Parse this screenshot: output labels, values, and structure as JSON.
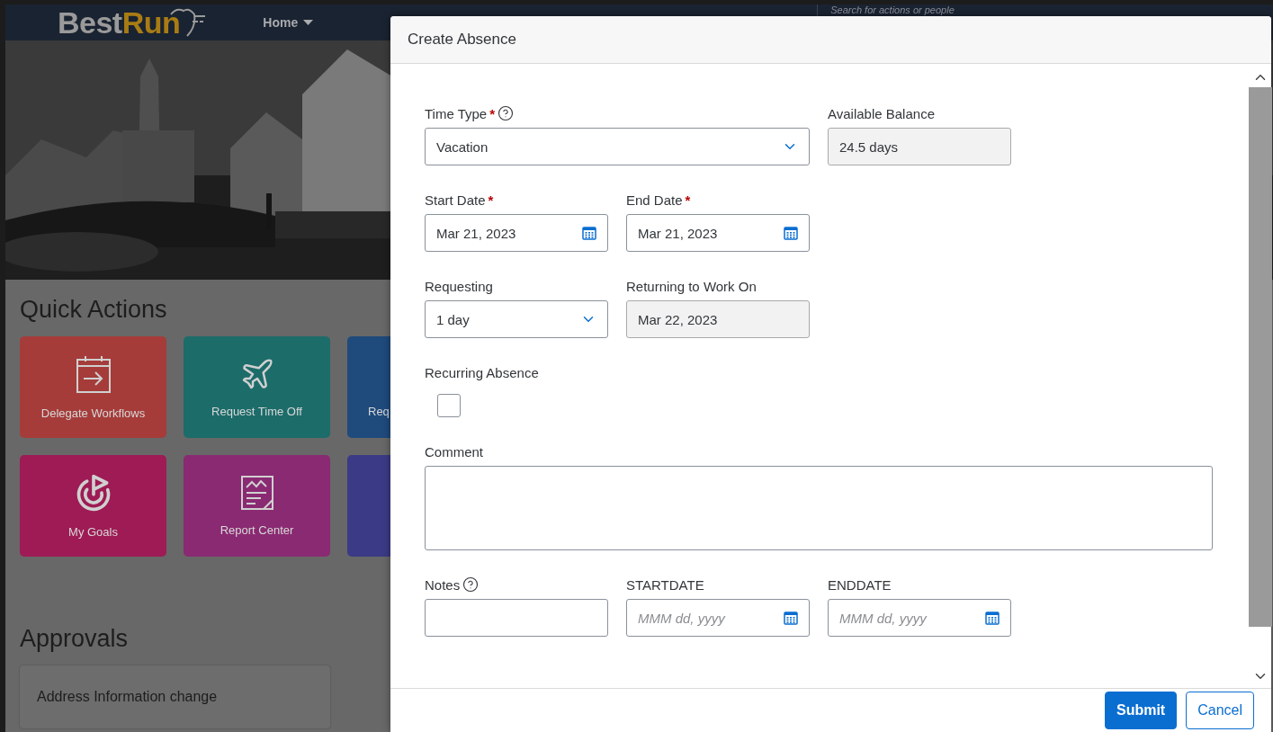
{
  "header": {
    "logo": {
      "part_1": "Best",
      "part_2": "Run"
    },
    "menu": "Home",
    "search": {
      "placeholder": "Search for actions or people"
    }
  },
  "quick_actions": {
    "title": "Quick Actions",
    "tiles": [
      {
        "label": "Delegate Workflows",
        "color": "#a53c3a"
      },
      {
        "label": "Request Time Off",
        "color": "#1c6c6a"
      },
      {
        "label": "Req",
        "color": "#1f4a7c"
      },
      {
        "label": "My Goals",
        "color": "#9e1b55"
      },
      {
        "label": "Report Center",
        "color": "#8a2a72"
      },
      {
        "color": "#3b3a86"
      }
    ]
  },
  "approvals": {
    "title": "Approvals",
    "items": [
      "Address Information change"
    ]
  },
  "dialog": {
    "title": "Create Absence",
    "rows": [
      [
        {
          "kind": "select",
          "label": "Time Type",
          "required_mark": "*",
          "help": true,
          "value": "Vacation",
          "colspan": 2
        },
        {
          "kind": "readonly",
          "label": "Available Balance",
          "value": "24.5 days"
        }
      ],
      [
        {
          "kind": "date",
          "label": "Start Date",
          "required_mark": "*",
          "value": "Mar 21, 2023"
        },
        {
          "kind": "date",
          "label": "End Date",
          "required_mark": "*",
          "value": "Mar 21, 2023"
        }
      ],
      [
        {
          "kind": "select",
          "label": "Requesting",
          "value": "1 day"
        },
        {
          "kind": "readonly",
          "label": "Returning to Work On",
          "value": "Mar 22, 2023"
        }
      ],
      [
        {
          "kind": "checkbox",
          "label": "Recurring Absence",
          "checked": false
        }
      ],
      [
        {
          "kind": "textarea",
          "label": "Comment",
          "colspan": 3
        }
      ],
      [
        {
          "kind": "text",
          "label": "Notes",
          "help": true
        },
        {
          "kind": "date",
          "label": "STARTDATE",
          "placeholder": "MMM dd, yyyy"
        },
        {
          "kind": "date",
          "label": "ENDDATE",
          "placeholder": "MMM dd, yyyy"
        }
      ]
    ],
    "buttons": [
      {
        "label": "Submit",
        "kind": "primary"
      },
      {
        "label": "Cancel",
        "kind": "secondary"
      }
    ]
  }
}
